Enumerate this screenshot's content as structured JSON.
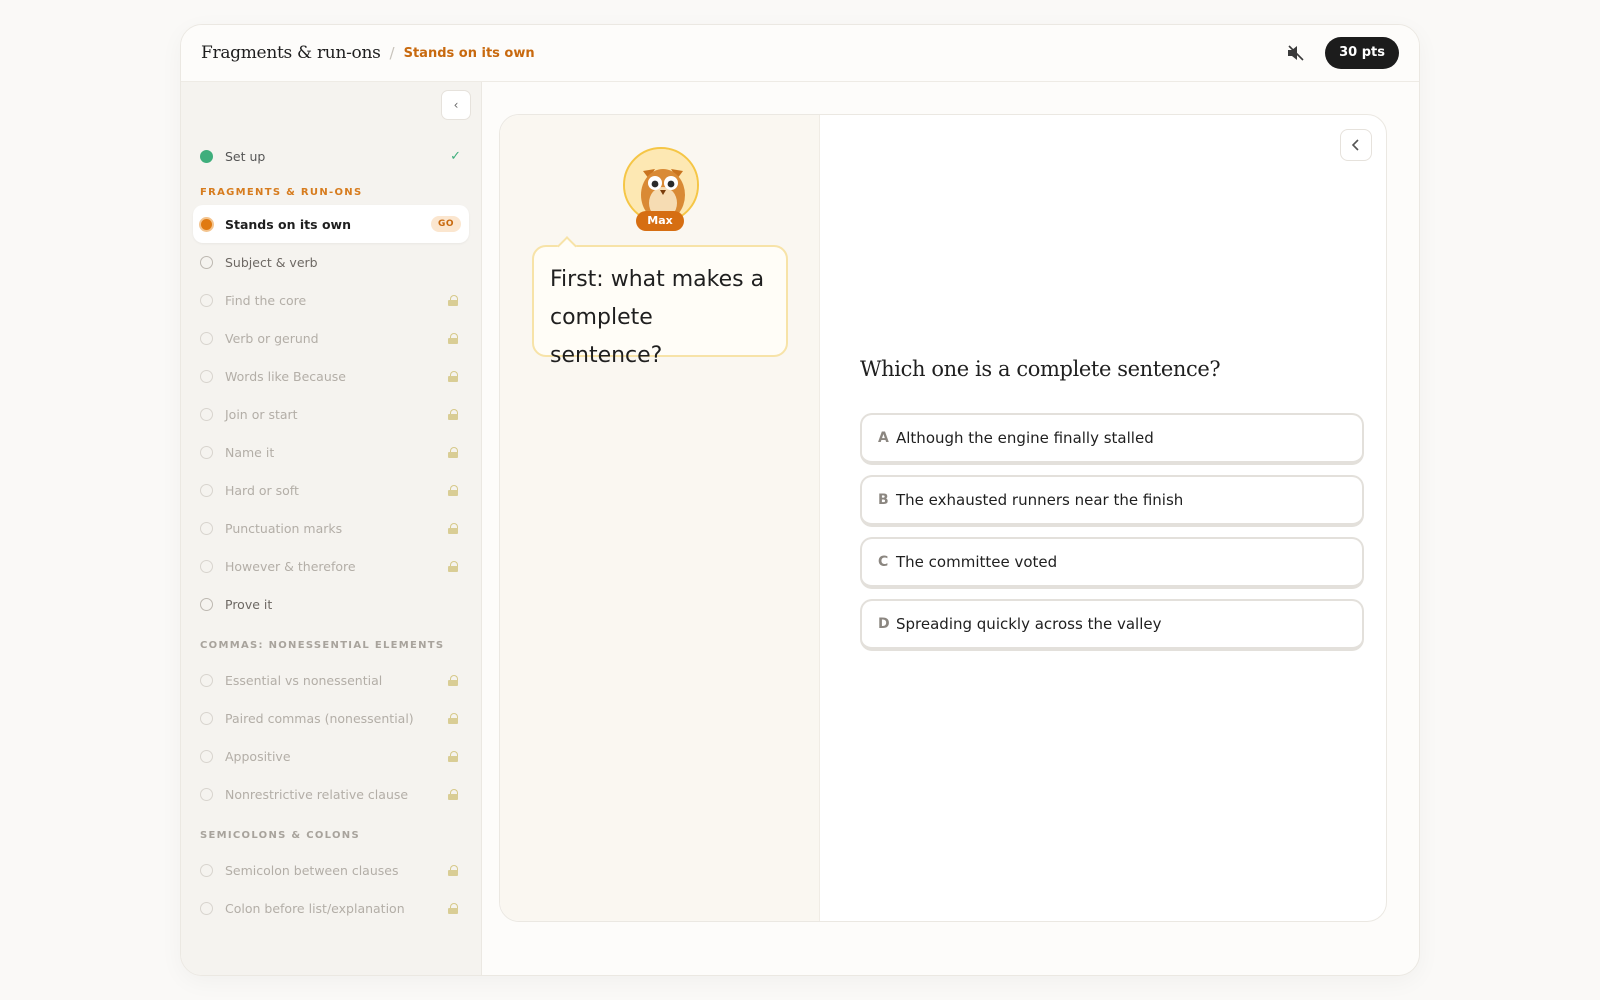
{
  "header": {
    "course": "Fragments & run-ons",
    "separator": "/",
    "lesson": "Stands on its own",
    "sound_icon": "speaker-muted-icon",
    "points": "30 pts"
  },
  "sidebar": {
    "collapse_icon": "chevron-left-icon",
    "setup": {
      "label": "Set up",
      "status": "done",
      "check": "✓"
    },
    "sections": [
      {
        "title": "FRAGMENTS & RUN-ONS",
        "items": [
          {
            "label": "Stands on its own",
            "state": "active",
            "badge": "GO"
          },
          {
            "label": "Subject & verb",
            "state": "open"
          },
          {
            "label": "Find the core",
            "state": "locked"
          },
          {
            "label": "Verb or gerund",
            "state": "locked"
          },
          {
            "label": "Words like Because",
            "state": "locked"
          },
          {
            "label": "Join or start",
            "state": "locked"
          },
          {
            "label": "Name it",
            "state": "locked"
          },
          {
            "label": "Hard or soft",
            "state": "locked"
          },
          {
            "label": "Punctuation marks",
            "state": "locked"
          },
          {
            "label": "However & therefore",
            "state": "locked"
          },
          {
            "label": "Prove it",
            "state": "open"
          }
        ]
      },
      {
        "title": "COMMAS: NONESSENTIAL ELEMENTS",
        "items": [
          {
            "label": "Essential vs nonessential",
            "state": "locked"
          },
          {
            "label": "Paired commas (nonessential)",
            "state": "locked"
          },
          {
            "label": "Appositive",
            "state": "locked"
          },
          {
            "label": "Nonrestrictive relative clause",
            "state": "locked"
          }
        ]
      },
      {
        "title": "SEMICOLONS & COLONS",
        "items": [
          {
            "label": "Semicolon between clauses",
            "state": "locked"
          },
          {
            "label": "Colon before list/explanation",
            "state": "locked"
          }
        ]
      }
    ]
  },
  "coach": {
    "name": "Max",
    "avatar_icon": "owl-icon",
    "message": "First: what makes a complete sentence?"
  },
  "quiz": {
    "back_icon": "chevron-left-icon",
    "question": "Which one is a complete sentence?",
    "options": [
      {
        "letter": "A",
        "text": "Although the engine finally stalled"
      },
      {
        "letter": "B",
        "text": "The exhausted runners near the finish"
      },
      {
        "letter": "C",
        "text": "The committee voted"
      },
      {
        "letter": "D",
        "text": "Spreading quickly across the valley"
      }
    ]
  },
  "colors": {
    "accent": "#d66e12",
    "done": "#3fae7c",
    "pts_bg": "#1c1c1c"
  }
}
